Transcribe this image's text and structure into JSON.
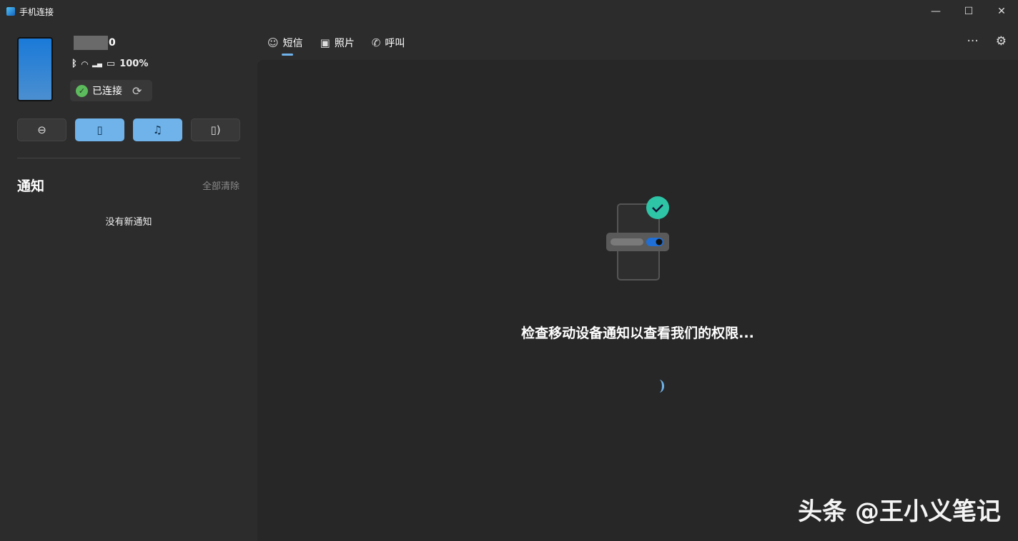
{
  "window": {
    "title": "手机连接",
    "minimize_icon": "minimize-icon",
    "maximize_icon": "maximize-icon",
    "close_icon": "close-icon"
  },
  "device": {
    "name_suffix": "0",
    "battery": "100%",
    "status": "已连接"
  },
  "notifications": {
    "title": "通知",
    "clear_all": "全部清除",
    "empty": "没有新通知"
  },
  "tabs": [
    {
      "label": "短信",
      "icon": "message-icon"
    },
    {
      "label": "照片",
      "icon": "photo-icon"
    },
    {
      "label": "呼叫",
      "icon": "phone-icon"
    }
  ],
  "main": {
    "message": "检查移动设备通知以查看我们的权限..."
  },
  "watermark": "头条 @王小义笔记",
  "colors": {
    "accent": "#6fb3ea",
    "success": "#5cbb5c"
  }
}
